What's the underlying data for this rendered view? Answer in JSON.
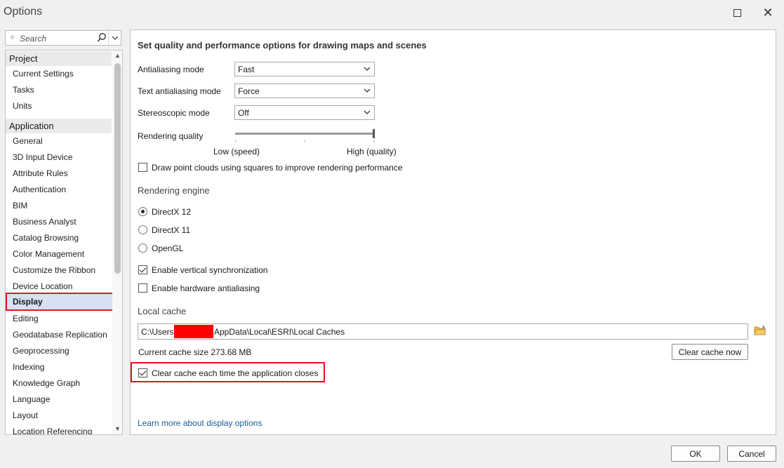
{
  "window": {
    "title": "Options"
  },
  "search": {
    "placeholder": "Search"
  },
  "nav": {
    "groups": [
      {
        "label": "Project",
        "items": [
          "Current Settings",
          "Tasks",
          "Units"
        ]
      },
      {
        "label": "Application",
        "items": [
          "General",
          "3D Input Device",
          "Attribute Rules",
          "Authentication",
          "BIM",
          "Business Analyst",
          "Catalog Browsing",
          "Color Management",
          "Customize the Ribbon",
          "Device Location",
          "Display",
          "Editing",
          "Geodatabase Replication",
          "Geoprocessing",
          "Indexing",
          "Knowledge Graph",
          "Language",
          "Layout",
          "Location Referencing"
        ]
      }
    ],
    "selected": "Display"
  },
  "main": {
    "heading": "Set quality and performance options for drawing maps and scenes",
    "antialiasing": {
      "label": "Antialiasing mode",
      "value": "Fast"
    },
    "text_antialiasing": {
      "label": "Text antialiasing mode",
      "value": "Force"
    },
    "stereoscopic": {
      "label": "Stereoscopic mode",
      "value": "Off"
    },
    "rendering_quality": {
      "label": "Rendering quality",
      "low": "Low (speed)",
      "high": "High (quality)",
      "level": 1.0
    },
    "point_clouds": {
      "label": "Draw point clouds using squares to improve rendering performance",
      "checked": false
    },
    "engine": {
      "title": "Rendering engine",
      "options": [
        "DirectX 12",
        "DirectX 11",
        "OpenGL"
      ],
      "selected": "DirectX 12"
    },
    "vsync": {
      "label": "Enable vertical synchronization",
      "checked": true
    },
    "hw_aa": {
      "label": "Enable hardware antialiasing",
      "checked": false
    },
    "cache": {
      "title": "Local cache",
      "path_prefix": "C:\\Users\\",
      "path_suffix": "AppData\\Local\\ESRI\\Local Caches",
      "size_text": "Current cache size 273.68 MB",
      "clear_button": "Clear cache now",
      "clear_on_close": {
        "label": "Clear cache each time the application closes",
        "checked": true
      }
    },
    "learn_more": "Learn more about display options"
  },
  "footer": {
    "ok": "OK",
    "cancel": "Cancel"
  },
  "colors": {
    "highlight": "#e8141e",
    "selection": "#d6e2f2",
    "link": "#1a5d99"
  }
}
